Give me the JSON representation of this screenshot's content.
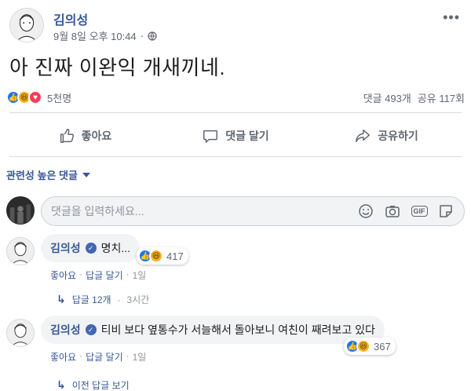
{
  "post": {
    "author": "김의성",
    "timestamp": "9월 8일 오후 10:44",
    "privacy_icon": "globe-icon",
    "text": "아 진짜 이완익 개새끼네.",
    "reaction_icons": [
      "like-icon",
      "haha-icon",
      "love-icon"
    ],
    "reaction_count": "5천명",
    "comment_count": "댓글 493개",
    "share_count": "공유 117회"
  },
  "actions": {
    "like": "좋아요",
    "comment": "댓글 달기",
    "share": "공유하기"
  },
  "sort": {
    "label": "관련성 높은 댓글"
  },
  "comment_input": {
    "placeholder": "댓글을 입력하세요..."
  },
  "comments": [
    {
      "author": "김의성",
      "text": "명치...",
      "reaction_count": "417",
      "like_label": "좋아요",
      "reply_label": "답글 달기",
      "age": "1일",
      "replies_label": "답글 12개",
      "replies_age": "3시간"
    },
    {
      "author": "김의성",
      "text": "티비 보다 옆통수가 서늘해서 돌아보니 여친이 째려보고 있다",
      "reaction_count": "367",
      "like_label": "좋아요",
      "reply_label": "답글 달기",
      "age": "1일",
      "replies_label": "이전 답글 보기"
    }
  ],
  "colors": {
    "link": "#385898",
    "like_blue": "#1877f2",
    "haha_yellow": "#f7b125",
    "love_red": "#f33e58",
    "muted": "#606770"
  }
}
